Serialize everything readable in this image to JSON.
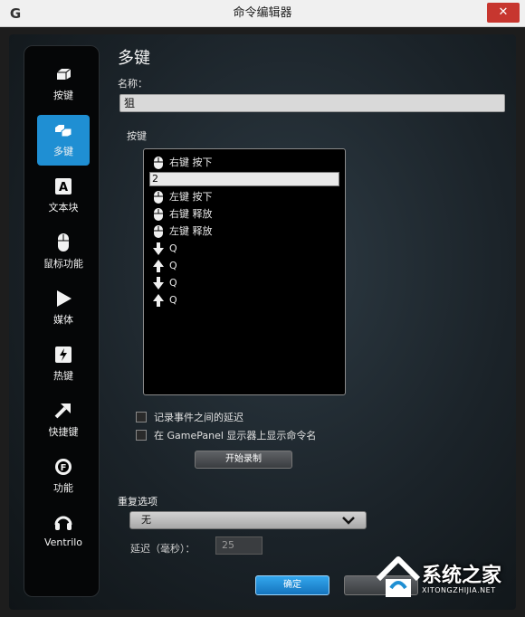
{
  "window": {
    "title": "命令编辑器",
    "logo": "G",
    "close_label": "✕"
  },
  "sidebar": {
    "items": [
      {
        "label": "按键",
        "icon": "key-icon",
        "active": false
      },
      {
        "label": "多键",
        "icon": "multikey-icon",
        "active": true
      },
      {
        "label": "文本块",
        "icon": "text-block-icon",
        "glyph": "A",
        "active": false
      },
      {
        "label": "鼠标功能",
        "icon": "mouse-icon",
        "active": false
      },
      {
        "label": "媒体",
        "icon": "play-icon",
        "active": false
      },
      {
        "label": "热键",
        "icon": "hotkey-icon",
        "active": false
      },
      {
        "label": "快捷键",
        "icon": "shortcut-arrow-icon",
        "active": false
      },
      {
        "label": "功能",
        "icon": "function-gear-icon",
        "glyph": "F",
        "active": false
      },
      {
        "label": "Ventrilo",
        "icon": "ventrilo-headset-icon",
        "active": false
      }
    ]
  },
  "main": {
    "title": "多键",
    "name_label": "名称：",
    "name_value": "狙",
    "keys_label": "按键",
    "key_events": [
      {
        "icon": "mouse-icon",
        "text": "右键 按下"
      },
      {
        "icon": "mouse-icon",
        "text": "左键 按下"
      },
      {
        "icon": "mouse-icon",
        "text": "右键 释放"
      },
      {
        "icon": "mouse-icon",
        "text": "左键 释放"
      },
      {
        "icon": "arrow-down-icon",
        "text": "Q"
      },
      {
        "icon": "arrow-up-icon",
        "text": "Q"
      },
      {
        "icon": "arrow-down-icon",
        "text": "Q"
      },
      {
        "icon": "arrow-up-icon",
        "text": "Q"
      }
    ],
    "edit_value": "2",
    "record_delay_label": "记录事件之间的延迟",
    "gamepanel_label": "在 GamePanel 显示器上显示命令名",
    "record_button": "开始录制",
    "repeat_label": "重复选项",
    "repeat_value": "无",
    "delay_label": "延迟（毫秒）：",
    "delay_value": "25",
    "ok_button": "确定"
  },
  "watermark": {
    "main": "系统之家",
    "sub": "XITONGZHIJIA.NET"
  },
  "colors": {
    "accent": "#1f8fd3",
    "close": "#c7362f"
  }
}
